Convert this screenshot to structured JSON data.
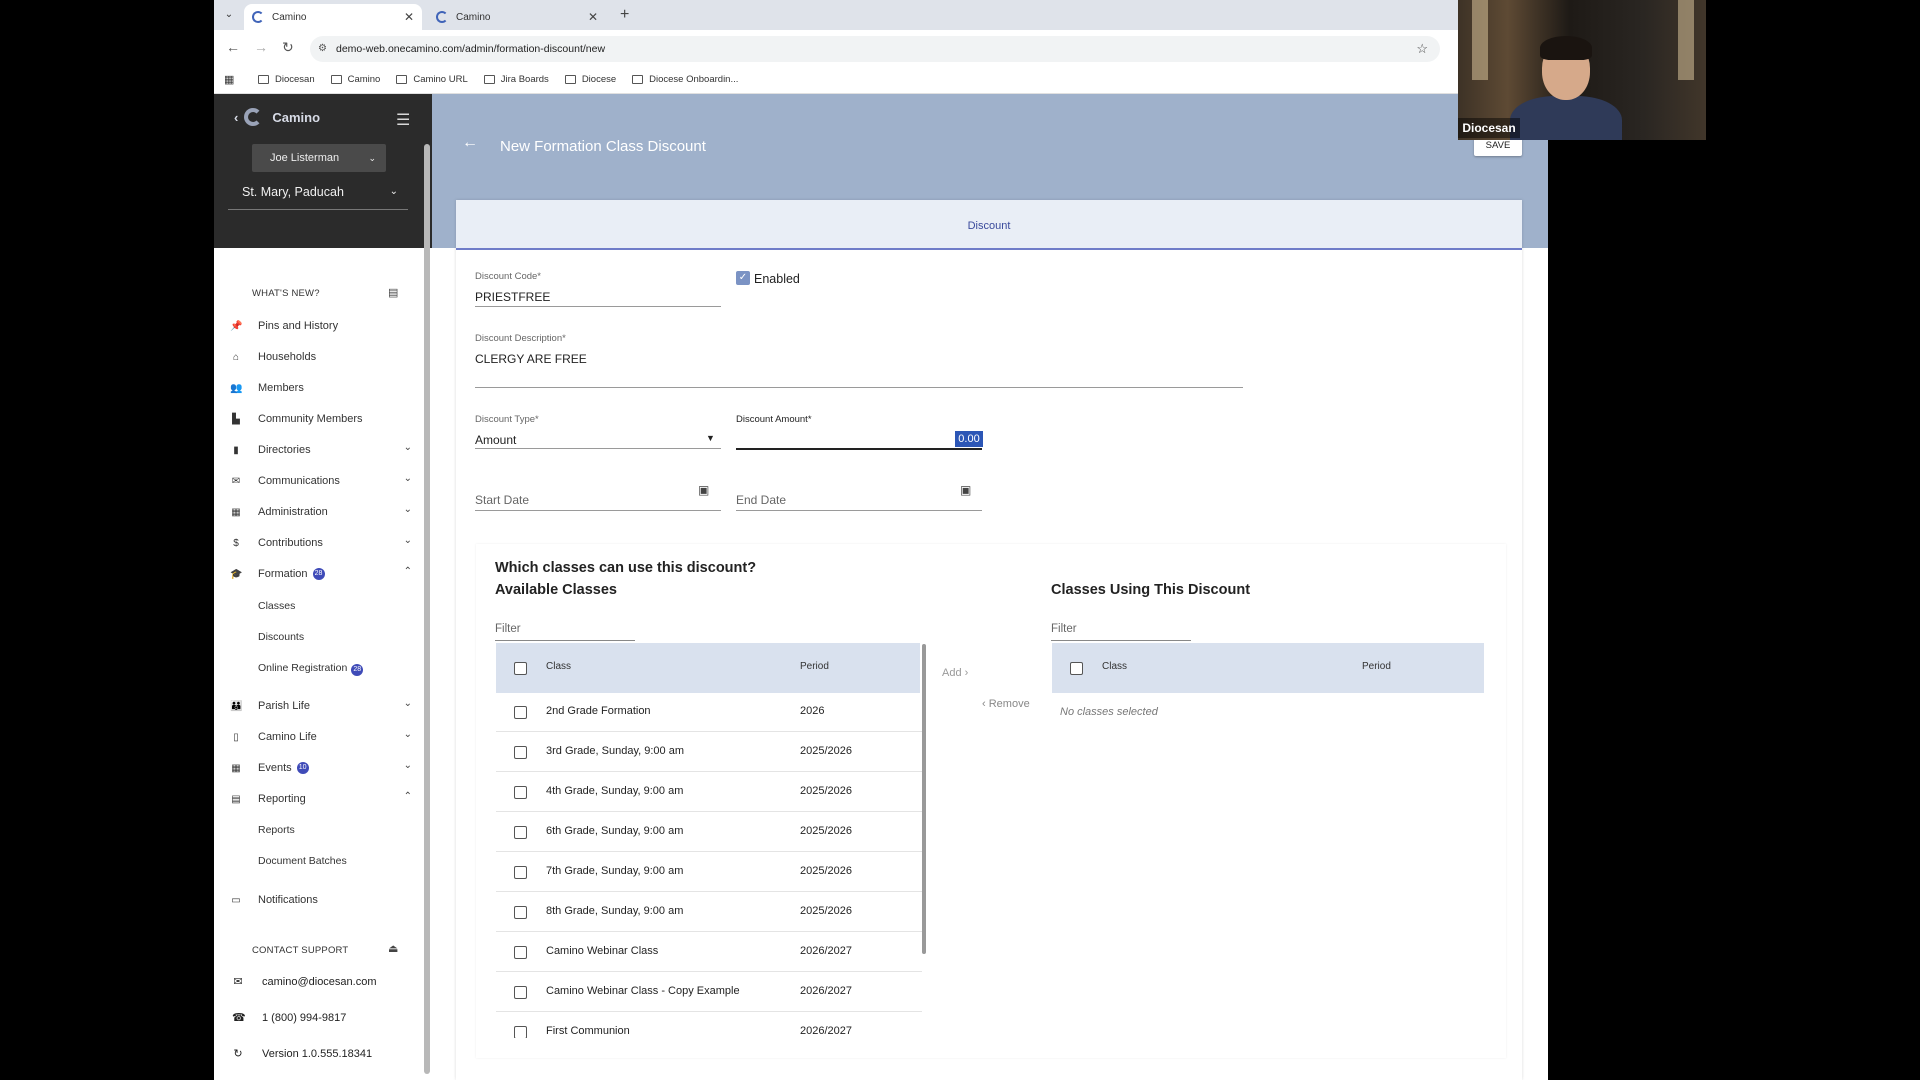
{
  "browser": {
    "tabs": [
      {
        "label": "Camino",
        "active": true
      },
      {
        "label": "Camino",
        "active": false
      }
    ],
    "url": "demo-web.onecamino.com/admin/formation-discount/new",
    "bookmarks": [
      "Diocesan",
      "Camino",
      "Camino URL",
      "Jira Boards",
      "Diocese",
      "Diocese Onboardin..."
    ]
  },
  "sidebar": {
    "brand": "Camino",
    "user": "Joe Listerman",
    "parish": "St. Mary, Paducah",
    "whats_new": "WHAT'S NEW?",
    "items": [
      {
        "label": "Pins and History",
        "icon": "pin-icon"
      },
      {
        "label": "Households",
        "icon": "home-icon"
      },
      {
        "label": "Members",
        "icon": "members-icon"
      },
      {
        "label": "Community Members",
        "icon": "community-icon"
      },
      {
        "label": "Directories",
        "icon": "book-icon"
      },
      {
        "label": "Communications",
        "icon": "mail-icon"
      },
      {
        "label": "Administration",
        "icon": "admin-icon"
      },
      {
        "label": "Contributions",
        "icon": "dollar-icon"
      },
      {
        "label": "Formation",
        "icon": "graduation-cap-icon",
        "badge": "28"
      },
      {
        "label": "Parish Life",
        "icon": "people-icon"
      },
      {
        "label": "Camino Life",
        "icon": "building-icon"
      },
      {
        "label": "Events",
        "icon": "calendar-icon",
        "badge": "10"
      },
      {
        "label": "Reporting",
        "icon": "report-icon"
      },
      {
        "label": "Notifications",
        "icon": "chat-icon"
      }
    ],
    "formation_sub": [
      {
        "label": "Classes"
      },
      {
        "label": "Discounts"
      },
      {
        "label": "Online Registration",
        "badge": "28"
      }
    ],
    "reporting_sub": [
      {
        "label": "Reports"
      },
      {
        "label": "Document Batches"
      }
    ],
    "contact_support": "CONTACT SUPPORT",
    "email": "camino@diocesan.com",
    "phone": "1 (800) 994-9817",
    "version": "Version 1.0.555.18341"
  },
  "header": {
    "title": "New Formation Class Discount",
    "save": "SAVE",
    "tab": "Discount"
  },
  "form": {
    "code_label": "Discount Code*",
    "code_value": "PRIESTFREE",
    "enabled_label": "Enabled",
    "enabled": true,
    "desc_label": "Discount Description*",
    "desc_value": "CLERGY ARE FREE",
    "type_label": "Discount Type*",
    "type_value": "Amount",
    "amount_label": "Discount Amount*",
    "amount_value": "0.00",
    "start_placeholder": "Start Date",
    "end_placeholder": "End Date"
  },
  "classes": {
    "question": "Which classes can use this discount?",
    "available_title": "Available Classes",
    "using_title": "Classes Using This Discount",
    "filter_placeholder": "Filter",
    "col_class": "Class",
    "col_period": "Period",
    "add": "Add",
    "remove": "Remove",
    "no_classes": "No classes selected",
    "available": [
      {
        "name": "2nd Grade Formation",
        "period": "2026"
      },
      {
        "name": "3rd Grade, Sunday, 9:00 am",
        "period": "2025/2026"
      },
      {
        "name": "4th Grade, Sunday, 9:00 am",
        "period": "2025/2026"
      },
      {
        "name": "6th Grade, Sunday, 9:00 am",
        "period": "2025/2026"
      },
      {
        "name": "7th Grade, Sunday, 9:00 am",
        "period": "2025/2026"
      },
      {
        "name": "8th Grade, Sunday, 9:00 am",
        "period": "2025/2026"
      },
      {
        "name": "Camino Webinar Class",
        "period": "2026/2027"
      },
      {
        "name": "Camino Webinar Class - Copy Example",
        "period": "2026/2027"
      },
      {
        "name": "First Communion",
        "period": "2026/2027"
      }
    ]
  },
  "webcam": {
    "name": "Diocesan"
  }
}
